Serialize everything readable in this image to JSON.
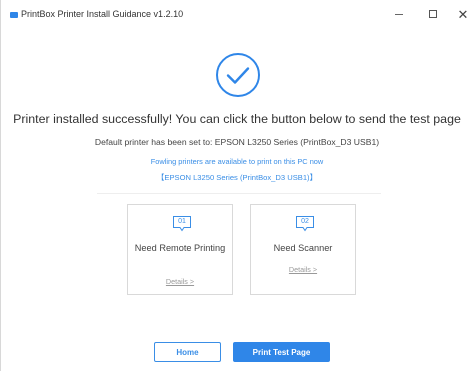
{
  "window": {
    "title": "PrintBox Printer Install Guidance v1.2.10",
    "accent_color": "#2f86e8"
  },
  "status": {
    "icon": "checkmark-circle-icon",
    "headline": "Printer installed successfully! You can click the button below to send the test page",
    "default_printer": "Default printer has been set to: EPSON L3250 Series (PrintBox_D3 USB1)",
    "available_note": "Fowling printers are available to print on this PC now",
    "printer_list": "【EPSON L3250 Series (PrintBox_D3 USB1)】"
  },
  "cards": [
    {
      "number": "01",
      "title": "Need Remote Printing",
      "link": "Details >"
    },
    {
      "number": "02",
      "title": "Need Scanner",
      "link": "Details >"
    }
  ],
  "actions": {
    "home_label": "Home",
    "print_label": "Print Test Page"
  }
}
